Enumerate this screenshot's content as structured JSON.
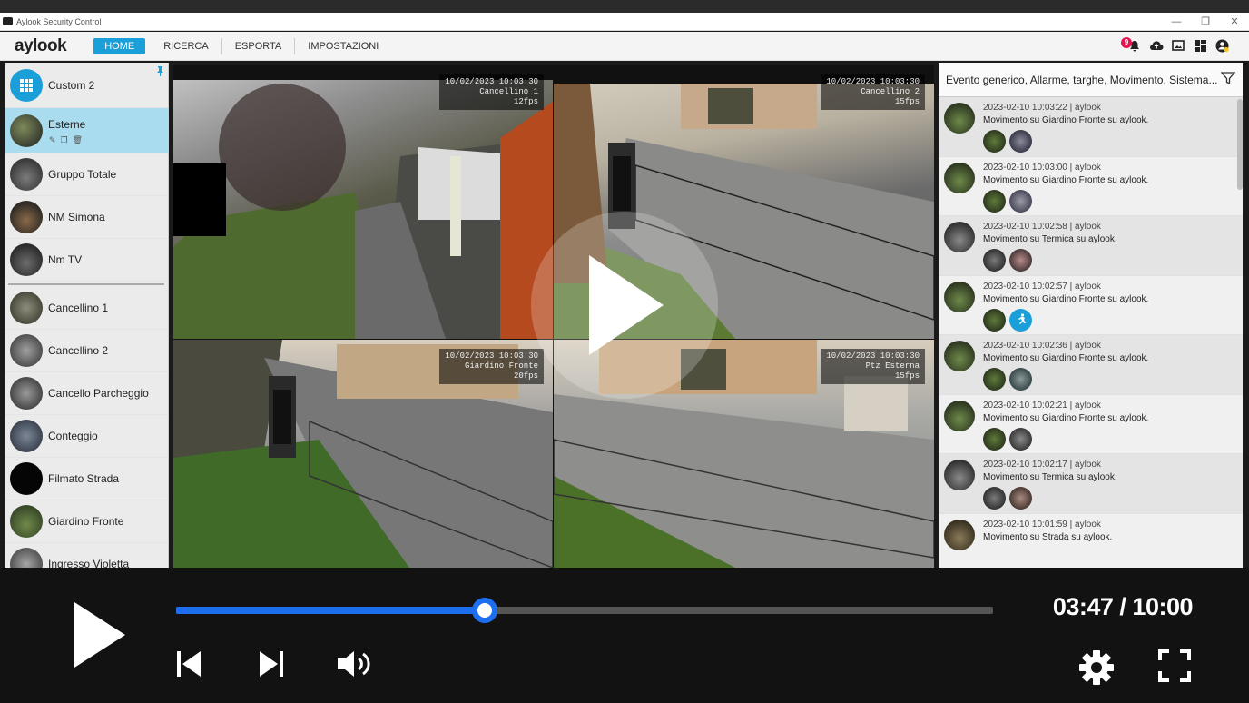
{
  "window": {
    "title": "Aylook Security Control",
    "minimize_icon": "—",
    "restore_icon": "❐",
    "close_icon": "✕"
  },
  "menubar": {
    "logo": "aylook",
    "items": [
      {
        "label": "HOME",
        "active": true
      },
      {
        "label": "RICERCA",
        "active": false
      },
      {
        "label": "ESPORTA",
        "active": false
      },
      {
        "label": "IMPOSTAZIONI",
        "active": false
      }
    ],
    "notification_count": "9"
  },
  "sidebar": {
    "items": [
      {
        "label": "Custom 2"
      },
      {
        "label": "Esterne"
      },
      {
        "label": "Gruppo Totale"
      },
      {
        "label": "NM Simona"
      },
      {
        "label": "Nm TV"
      },
      {
        "label": "Cancellino 1"
      },
      {
        "label": "Cancellino 2"
      },
      {
        "label": "Cancello Parcheggio"
      },
      {
        "label": "Conteggio"
      },
      {
        "label": "Filmato Strada"
      },
      {
        "label": "Giardino Fronte"
      },
      {
        "label": "Ingresso Violetta"
      }
    ]
  },
  "cameras": [
    {
      "timestamp": "10/02/2023 10:03:30",
      "name": "Cancellino 1",
      "fps": "12fps"
    },
    {
      "timestamp": "10/02/2023 10:03:30",
      "name": "Cancellino 2",
      "fps": "15fps"
    },
    {
      "timestamp": "10/02/2023 10:03:30",
      "name": "Giardino Fronte",
      "fps": "20fps"
    },
    {
      "timestamp": "10/02/2023 10:03:30",
      "name": "Ptz Esterna",
      "fps": "15fps"
    }
  ],
  "events": {
    "filter_title": "Evento generico, Allarme, targhe, Movimento, Sistema...",
    "items": [
      {
        "meta": "2023-02-10 10:03:22 | aylook",
        "desc": "Movimento su Giardino Fronte su aylook."
      },
      {
        "meta": "2023-02-10 10:03:00 | aylook",
        "desc": "Movimento su Giardino Fronte su aylook."
      },
      {
        "meta": "2023-02-10 10:02:58 | aylook",
        "desc": "Movimento su Termica su aylook."
      },
      {
        "meta": "2023-02-10 10:02:57 | aylook",
        "desc": "Movimento su Giardino Fronte su aylook."
      },
      {
        "meta": "2023-02-10 10:02:36 | aylook",
        "desc": "Movimento su Giardino Fronte su aylook."
      },
      {
        "meta": "2023-02-10 10:02:21 | aylook",
        "desc": "Movimento su Giardino Fronte su aylook."
      },
      {
        "meta": "2023-02-10 10:02:17 | aylook",
        "desc": "Movimento su Termica su aylook."
      },
      {
        "meta": "2023-02-10 10:01:59 | aylook",
        "desc": "Movimento su Strada su aylook."
      }
    ]
  },
  "player": {
    "time_display": "03:47 / 10:00",
    "progress_fraction": 0.3783,
    "accent_color": "#1d6ff0"
  }
}
